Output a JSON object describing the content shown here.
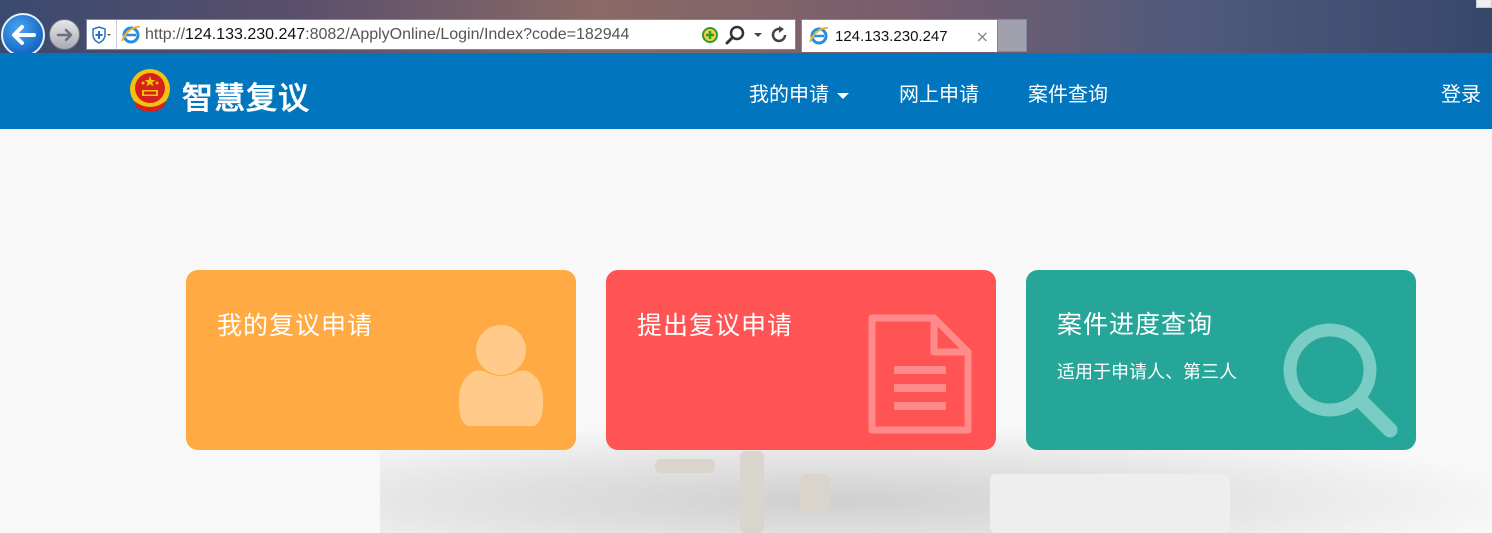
{
  "browser": {
    "url_prefix": "http://",
    "url_host": "124.133.230.247",
    "url_rest": ":8082/ApplyOnline/Login/Index?code=182944",
    "tab_title": "124.133.230.247",
    "tab_close": "×"
  },
  "nav": {
    "site_title": "智慧复议",
    "items": [
      {
        "label": "我的申请",
        "has_dropdown": true
      },
      {
        "label": "网上申请"
      },
      {
        "label": "案件查询"
      }
    ],
    "login": "登录",
    "color": "#0176be"
  },
  "cards": [
    {
      "title": "我的复议申请",
      "subtitle": "",
      "color": "#ffaa42",
      "icon": "user-icon"
    },
    {
      "title": "提出复议申请",
      "subtitle": "",
      "color": "#ff5354",
      "icon": "document-icon"
    },
    {
      "title": "案件进度查询",
      "subtitle": "适用于申请人、第三人",
      "color": "#26a599",
      "icon": "search-icon"
    }
  ]
}
